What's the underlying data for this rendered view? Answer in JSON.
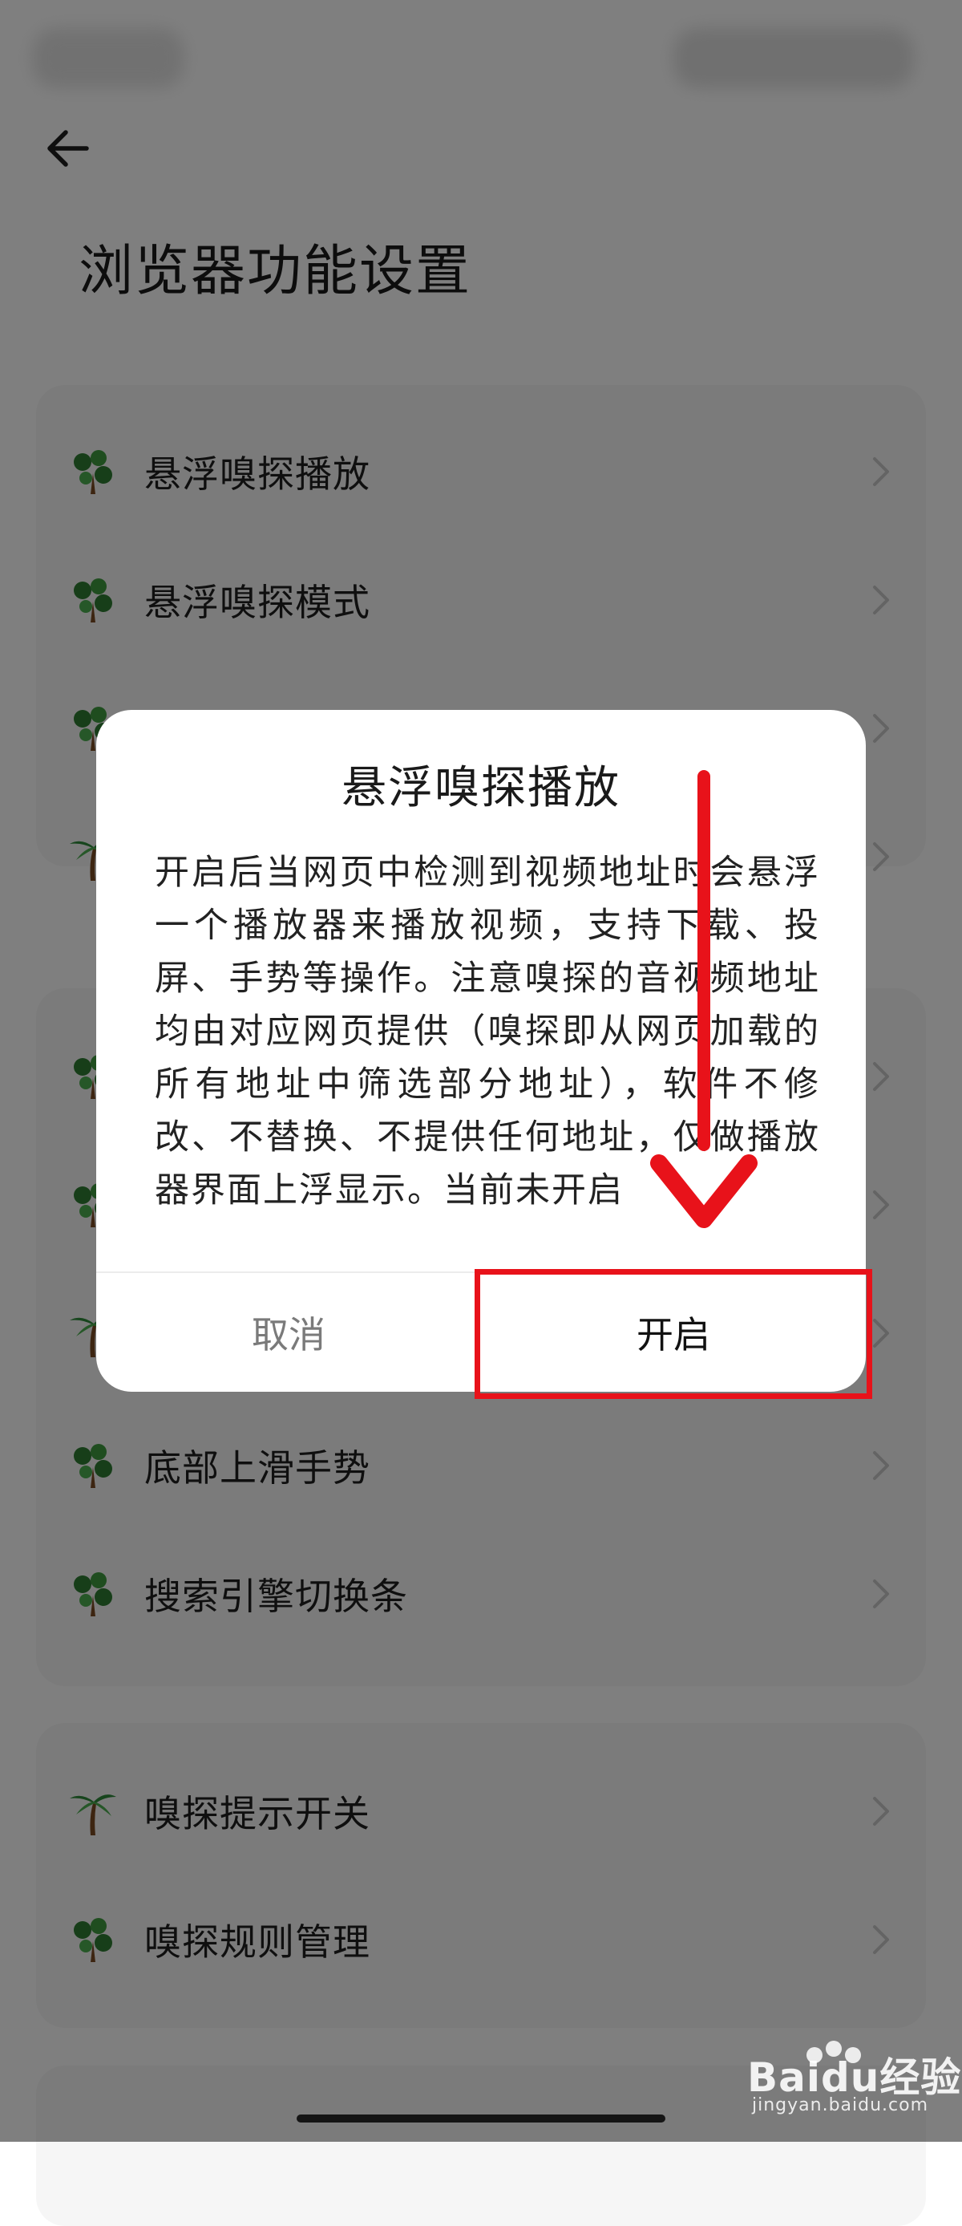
{
  "header": {
    "title": "浏览器功能设置"
  },
  "colors": {
    "accent_red": "#e8121a",
    "card_bg": "#f6f6f6",
    "scrim": "rgba(0,0,0,0.5)"
  },
  "sections": [
    {
      "items": [
        {
          "label": "悬浮嗅探播放",
          "icon": "tree-icon"
        },
        {
          "label": "悬浮嗅探模式",
          "icon": "tree-icon"
        },
        {
          "label": "",
          "icon": "tree-icon"
        },
        {
          "label": "",
          "icon": "palm-tree-icon"
        }
      ]
    },
    {
      "items": [
        {
          "label": "",
          "icon": "tree-icon"
        },
        {
          "label": "",
          "icon": "tree-icon"
        },
        {
          "label": "",
          "icon": "palm-tree-icon"
        },
        {
          "label": "底部上滑手势",
          "icon": "tree-icon"
        },
        {
          "label": "搜索引擎切换条",
          "icon": "tree-icon"
        }
      ]
    },
    {
      "items": [
        {
          "label": "嗅探提示开关",
          "icon": "palm-tree-icon"
        },
        {
          "label": "嗅探规则管理",
          "icon": "tree-icon"
        }
      ]
    }
  ],
  "dialog": {
    "title": "悬浮嗅探播放",
    "body": "开启后当网页中检测到视频地址时会悬浮一个播放器来播放视频，支持下载、投屏、手势等操作。注意嗅探的音视频地址均由对应网页提供（嗅探即从网页加载的所有地址中筛选部分地址），软件不修改、不替换、不提供任何地址，仅做播放器界面上浮显示。当前未开启",
    "cancel_label": "取消",
    "confirm_label": "开启"
  },
  "watermark": {
    "brand": "Baidu经验",
    "sub": "jingyan.baidu.com"
  }
}
